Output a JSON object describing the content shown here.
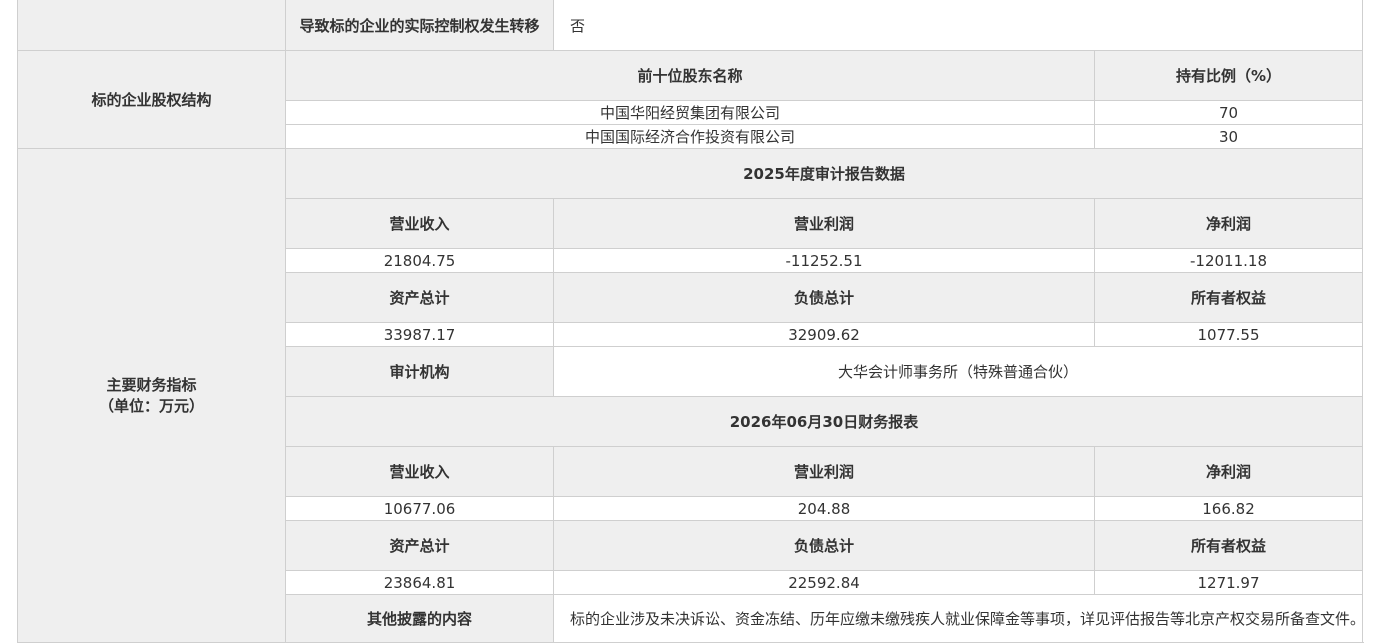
{
  "control_transfer": {
    "label": "导致标的企业的实际控制权发生转移",
    "value": "否"
  },
  "equity": {
    "label": "标的企业股权结构",
    "headers": {
      "name": "前十位股东名称",
      "ratio": "持有比例（%）"
    },
    "rows": [
      {
        "name": "中国华阳经贸集团有限公司",
        "ratio": "70"
      },
      {
        "name": "中国国际经济合作投资有限公司",
        "ratio": "30"
      }
    ]
  },
  "finance": {
    "label_line1": "主要财务指标",
    "label_line2": "（单位：万元）",
    "audit": {
      "title": "2025年度审计报告数据",
      "h_revenue": "营业收入",
      "h_operating_profit": "营业利润",
      "h_net_profit": "净利润",
      "revenue": "21804.75",
      "operating_profit": "-11252.51",
      "net_profit": "-12011.18",
      "h_assets": "资产总计",
      "h_liabilities": "负债总计",
      "h_equity": "所有者权益",
      "assets": "33987.17",
      "liabilities": "32909.62",
      "equity": "1077.55",
      "h_auditor": "审计机构",
      "auditor": "大华会计师事务所（特殊普通合伙）"
    },
    "interim": {
      "title": "2026年06月30日财务报表",
      "h_revenue": "营业收入",
      "h_operating_profit": "营业利润",
      "h_net_profit": "净利润",
      "revenue": "10677.06",
      "operating_profit": "204.88",
      "net_profit": "166.82",
      "h_assets": "资产总计",
      "h_liabilities": "负债总计",
      "h_equity": "所有者权益",
      "assets": "23864.81",
      "liabilities": "22592.84",
      "equity": "1271.97"
    }
  },
  "other": {
    "label": "其他披露的内容",
    "value": "标的企业涉及未决诉讼、资金冻结、历年应缴未缴残疾人就业保障金等事项，详见评估报告等北京产权交易所备查文件。"
  }
}
